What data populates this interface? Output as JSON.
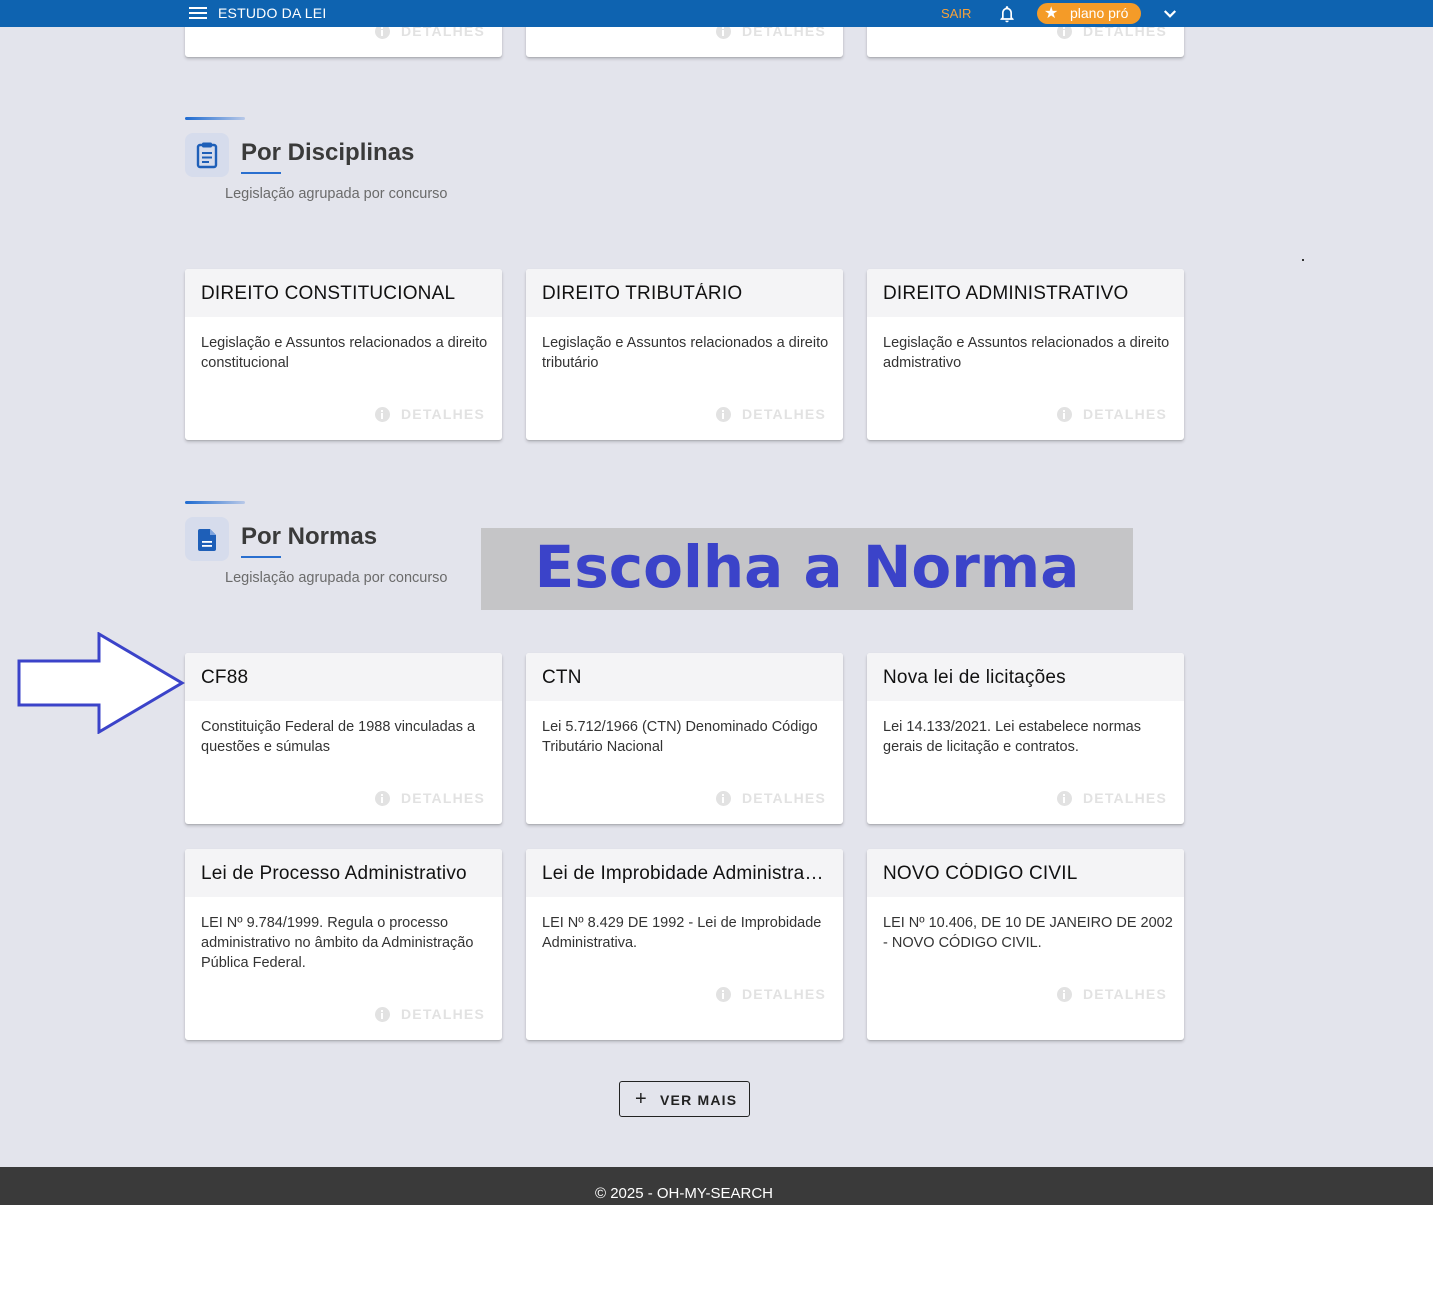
{
  "header": {
    "title": "ESTUDO DA LEI",
    "logout_label": "SAIR",
    "plan_label": "plano pró",
    "icons": [
      "menu-icon",
      "bell-icon",
      "star-icon",
      "chevron-down-icon"
    ]
  },
  "top_cards": [
    {
      "details_label": "DETALHES"
    },
    {
      "details_label": "DETALHES"
    },
    {
      "details_label": "DETALHES"
    }
  ],
  "sections": {
    "disciplinas": {
      "title": "Por Disciplinas",
      "subtitle": "Legislação agrupada por concurso",
      "icon": "clipboard-icon",
      "cards": [
        {
          "title": "DIREITO CONSTITUCIONAL",
          "description": "Legislação e Assuntos relacionados a direito constitucional",
          "details_label": "DETALHES"
        },
        {
          "title": "DIREITO TRIBUTÁRIO",
          "description": "Legislação e Assuntos relacionados a direito tributário",
          "details_label": "DETALHES"
        },
        {
          "title": "DIREITO ADMINISTRATIVO",
          "description": "Legislação e Assuntos relacionados a direito admistrativo",
          "details_label": "DETALHES"
        }
      ]
    },
    "normas": {
      "title": "Por Normas",
      "subtitle": "Legislação agrupada por concurso",
      "icon": "document-icon",
      "cards": [
        {
          "title": "CF88",
          "description": "Constituição Federal de 1988 vinculadas a questões e súmulas",
          "details_label": "DETALHES"
        },
        {
          "title": "CTN",
          "description": "Lei 5.712/1966 (CTN) Denominado Código Tributário Nacional",
          "details_label": "DETALHES"
        },
        {
          "title": "Nova lei de licitações",
          "description": "Lei 14.133/2021. Lei estabelece normas gerais de licitação e contratos.",
          "details_label": "DETALHES"
        },
        {
          "title": "Lei de Processo Administrativo",
          "description": "LEI Nº 9.784/1999. Regula o processo administrativo no âmbito da Administração Pública Federal.",
          "details_label": "DETALHES"
        },
        {
          "title": "Lei de Improbidade Administrativa",
          "description": "LEI Nº 8.429 DE 1992 - Lei de Improbidade Administrativa.",
          "details_label": "DETALHES"
        },
        {
          "title": "NOVO CÓDIGO CIVIL",
          "description": "LEI Nº 10.406, DE 10 DE JANEIRO DE 2002 - NOVO CÓDIGO CIVIL.",
          "details_label": "DETALHES"
        }
      ]
    }
  },
  "overlay": {
    "text": "Escolha a Norma",
    "arrow_icon": "arrow-right-icon"
  },
  "more_button": {
    "label": "VER MAIS",
    "icon": "plus-icon"
  },
  "footer": {
    "text": "© 2025 - OH-MY-SEARCH"
  },
  "colors": {
    "topbar": "#0e63b0",
    "accent": "#2a6fcf",
    "plan_badge": "#f49b28",
    "logout": "#f7a23a",
    "page_bg": "#e3e4ec",
    "overlay_text": "#3b43c9",
    "footer_bg": "#3a3a3a"
  }
}
